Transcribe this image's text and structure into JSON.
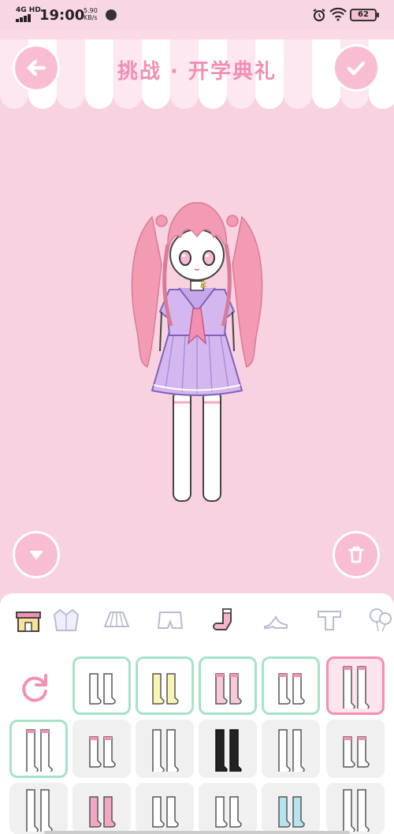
{
  "status_bar": {
    "signal_label": "4G HD",
    "time": "19:00",
    "net_speed_value": "5.90",
    "net_speed_unit": "KB/s",
    "battery": "62"
  },
  "header": {
    "title": "挑战 · 开学典礼",
    "back_icon": "arrow-left-icon",
    "confirm_icon": "check-icon"
  },
  "stage": {
    "collapse_icon": "triangle-down-icon",
    "delete_icon": "trash-icon"
  },
  "category_tabs": [
    {
      "name": "shop",
      "icon": "shop-icon",
      "active": false
    },
    {
      "name": "jacket",
      "icon": "jacket-icon",
      "active": false
    },
    {
      "name": "skirt",
      "icon": "skirt-icon",
      "active": false
    },
    {
      "name": "shorts",
      "icon": "shorts-icon",
      "active": false
    },
    {
      "name": "socks",
      "icon": "sock-icon",
      "active": true
    },
    {
      "name": "shoes",
      "icon": "high-heel-icon",
      "active": false
    },
    {
      "name": "shirt",
      "icon": "t-shirt-icon",
      "active": false
    },
    {
      "name": "accessory",
      "icon": "balloon-icon",
      "active": false
    }
  ],
  "items": [
    {
      "kind": "refresh",
      "icon": "refresh-icon"
    },
    {
      "kind": "short-white-socks",
      "state": "owned",
      "color": "#ffffff"
    },
    {
      "kind": "yellow-striped-socks",
      "state": "owned",
      "color": "#f9f5b4"
    },
    {
      "kind": "pink-toe-socks",
      "state": "owned",
      "color": "#f9c9d8"
    },
    {
      "kind": "cherry-socks",
      "state": "owned",
      "color": "#ffffff"
    },
    {
      "kind": "thigh-highs-pink-top",
      "state": "selected",
      "color": "#ffffff"
    },
    {
      "kind": "bow-thigh-highs",
      "state": "owned",
      "color": "#ffffff"
    },
    {
      "kind": "ruffle-short-socks",
      "state": "locked",
      "color": "#ffffff"
    },
    {
      "kind": "white-knee-socks",
      "state": "locked",
      "color": "#ffffff"
    },
    {
      "kind": "black-knee-socks",
      "state": "locked",
      "color": "#222222"
    },
    {
      "kind": "lace-tights",
      "state": "locked",
      "color": "#ffffff"
    },
    {
      "kind": "pink-bow-ankle-socks",
      "state": "locked",
      "color": "#ffffff"
    },
    {
      "kind": "white-tights",
      "state": "locked",
      "color": "#ffffff"
    },
    {
      "kind": "purple-striped-socks",
      "state": "locked",
      "color": "#f3a6c4"
    },
    {
      "kind": "crown-socks",
      "state": "locked",
      "color": "#ffffff"
    },
    {
      "kind": "dotted-socks",
      "state": "locked",
      "color": "#ffffff"
    },
    {
      "kind": "blue-stripe-socks",
      "state": "locked",
      "color": "#b7e3ef"
    },
    {
      "kind": "tall-white-socks",
      "state": "locked",
      "color": "#ffffff"
    }
  ],
  "colors": {
    "background": "#f9d2e2",
    "accent": "#f08eb5",
    "owned_border": "#a6e3c6",
    "selected_border": "#f48fb4"
  }
}
